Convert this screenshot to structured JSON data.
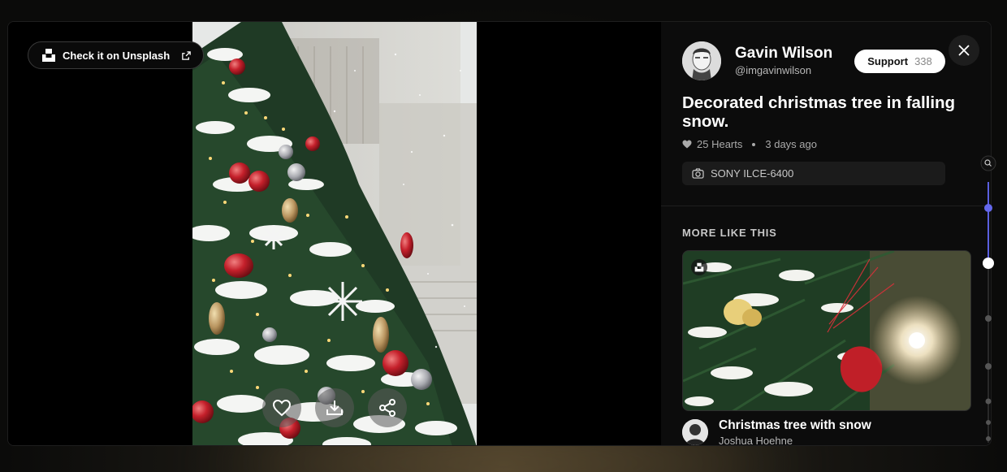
{
  "unsplash_link": {
    "label": "Check it on Unsplash"
  },
  "author": {
    "name": "Gavin Wilson",
    "handle": "@imgavinwilson"
  },
  "support": {
    "label": "Support",
    "count": "338"
  },
  "photo": {
    "title": "Decorated christmas tree in falling snow.",
    "hearts": "25 Hearts",
    "posted": "3 days ago",
    "camera": "SONY ILCE-6400"
  },
  "more": {
    "section_title": "MORE LIKE THIS",
    "items": [
      {
        "title": "Christmas tree with snow",
        "author": "Joshua Hoehne"
      }
    ]
  },
  "icons": {
    "unsplash": "unsplash-logo-icon",
    "external": "external-link-icon",
    "close": "close-icon",
    "heart": "heart-icon",
    "download": "download-icon",
    "share": "share-icon",
    "camera": "camera-icon",
    "search": "search-icon"
  },
  "colors": {
    "accent": "#5b5fe0",
    "background": "#000000",
    "panel": "#0c0c0c"
  }
}
